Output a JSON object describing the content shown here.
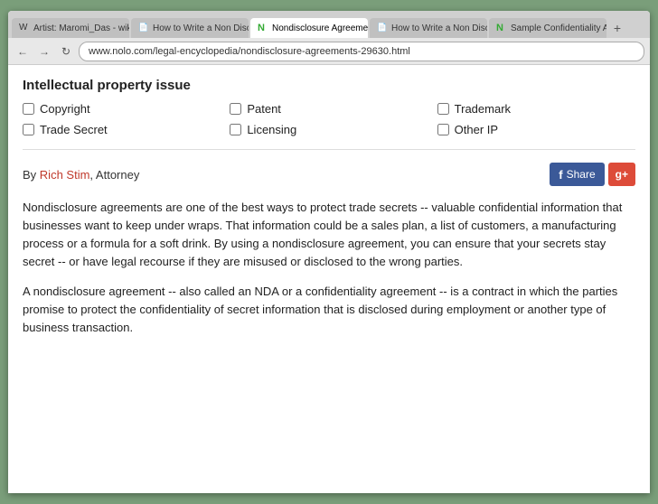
{
  "browser": {
    "tabs": [
      {
        "id": "tab1",
        "label": "Artist: Maromi_Das - wiki...",
        "favicon": "W",
        "active": false
      },
      {
        "id": "tab2",
        "label": "How to Write a Non Discl...",
        "favicon": "📄",
        "active": false
      },
      {
        "id": "tab3",
        "label": "Nondisclosure Agreement...",
        "favicon": "N",
        "active": true
      },
      {
        "id": "tab4",
        "label": "How to Write a Non Discl...",
        "favicon": "📄",
        "active": false
      },
      {
        "id": "tab5",
        "label": "Sample Confidentiality Ag...",
        "favicon": "N",
        "active": false
      }
    ],
    "url": "www.nolo.com/legal-encyclopedia/nondisclosure-agreements-29630.html"
  },
  "page": {
    "section_title": "Intellectual property issue",
    "checkboxes": [
      {
        "id": "copyright",
        "label": "Copyright",
        "checked": false
      },
      {
        "id": "patent",
        "label": "Patent",
        "checked": false
      },
      {
        "id": "trademark",
        "label": "Trademark",
        "checked": false
      },
      {
        "id": "trade_secret",
        "label": "Trade Secret",
        "checked": false
      },
      {
        "id": "licensing",
        "label": "Licensing",
        "checked": false
      },
      {
        "id": "other_ip",
        "label": "Other IP",
        "checked": false
      }
    ],
    "author": {
      "prefix": "By ",
      "name": "Rich Stim",
      "suffix": ", Attorney"
    },
    "social": {
      "share_label": "Share",
      "gplus_label": "g+"
    },
    "paragraphs": [
      "Nondisclosure agreements are one of the best ways to protect trade secrets -- valuable confidential information that businesses want to keep under wraps. That information could be a sales plan, a list of customers, a manufacturing process or a formula for a soft drink. By using a nondisclosure agreement, you can ensure that your secrets stay secret -- or have legal recourse if they are misused or disclosed to the wrong parties.",
      "A nondisclosure agreement -- also called an NDA or a confidentiality agreement -- is a contract in which the parties promise to protect the confidentiality of secret information that is disclosed during employment or another type of business transaction."
    ]
  }
}
